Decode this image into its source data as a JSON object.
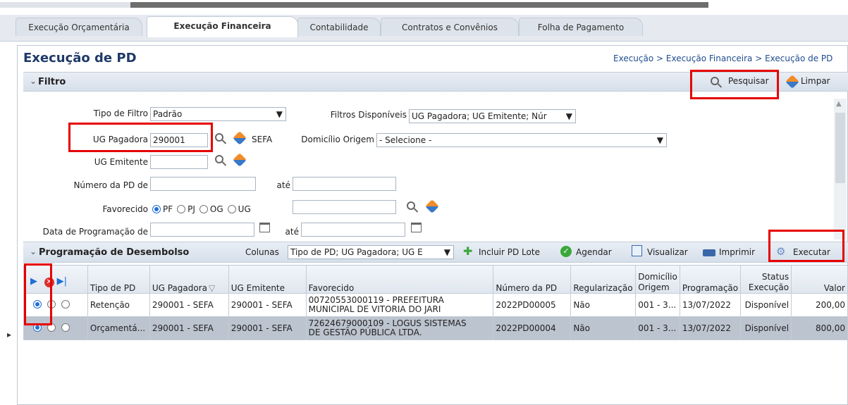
{
  "tabs": [
    {
      "label": "Execução Orçamentária"
    },
    {
      "label": "Execução Financeira"
    },
    {
      "label": "Contabilidade"
    },
    {
      "label": "Contratos e Convênios"
    },
    {
      "label": "Folha de Pagamento"
    }
  ],
  "page": {
    "title": "Execução de PD",
    "breadcrumb": "Execução > Execução Financeira > Execução de PD"
  },
  "filtro": {
    "title": "Filtro",
    "pesquisar_label": "Pesquisar",
    "limpar_label": "Limpar",
    "tipo_filtro_label": "Tipo de Filtro",
    "tipo_filtro_value": "Padrão",
    "filtros_disp_label": "Filtros Disponíveis",
    "filtros_disp_value": "UG Pagadora; UG Emitente; Núr",
    "ug_pagadora_label": "UG Pagadora",
    "ug_pagadora_value": "290001",
    "ug_pagadora_desc": "SEFA",
    "dominio_label": "Domicílio Origem",
    "dominio_value": "- Selecione -",
    "ug_emitente_label": "UG Emitente",
    "numero_pd_label": "Número da PD de",
    "ate_label": "até",
    "favorecido_label": "Favorecido",
    "favorecido_options": [
      "PF",
      "PJ",
      "OG",
      "UG"
    ],
    "data_prog_label": "Data de Programação de",
    "ate2_label": "até"
  },
  "programacao": {
    "title": "Programação de Desembolso",
    "colunas_label": "Colunas",
    "colunas_value": "Tipo de PD; UG Pagadora; UG E",
    "incluir_label": "Incluir PD Lote",
    "agendar_label": "Agendar",
    "visualizar_label": "Visualizar",
    "imprimir_label": "Imprimir",
    "executar_label": "Executar"
  },
  "table": {
    "headers": {
      "tipo": "Tipo de PD",
      "ug_pag": "UG Pagadora",
      "ug_emit": "UG Emitente",
      "favorecido": "Favorecido",
      "numero": "Número da PD",
      "regularizacao": "Regularização",
      "dominio_1": "Domicílio",
      "dominio_2": "Origem",
      "programacao": "Programação",
      "status_1": "Status",
      "status_2": "Execução",
      "valor": "Valor"
    },
    "rows": [
      {
        "tipo": "Retenção",
        "ug_pag": "290001 - SEFA",
        "ug_emit": "290001 - SEFA",
        "fav_1": "00720553000119 - PREFEITURA",
        "fav_2": "MUNICIPAL DE VITORIA DO JARI",
        "numero": "2022PD00005",
        "reg": "Não",
        "dominio": "001 - 3...",
        "prog": "13/07/2022",
        "status": "Disponível",
        "valor": "200,00"
      },
      {
        "tipo": "Orçamentá...",
        "ug_pag": "290001 - SEFA",
        "ug_emit": "290001 - SEFA",
        "fav_1": "72624679000109 - LOGUS SISTEMAS",
        "fav_2": "DE GESTÃO PÚBLICA LTDA.",
        "numero": "2022PD00004",
        "reg": "Não",
        "dominio": "001 - 3...",
        "prog": "13/07/2022",
        "status": "Disponível",
        "valor": "800,00"
      }
    ]
  },
  "colors": {
    "highlight": "#e60000",
    "title": "#1f3a68",
    "selected_row": "#bcc4cf"
  }
}
